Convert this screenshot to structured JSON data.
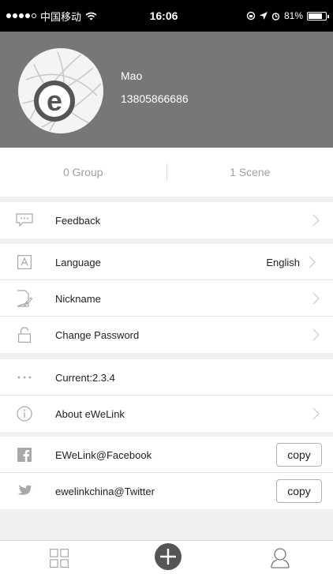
{
  "status_bar": {
    "carrier": "中国移动",
    "time": "16:06",
    "battery": "81%",
    "battery_level": 0.81
  },
  "profile": {
    "avatar_letter": "e",
    "name": "Mao",
    "phone": "13805866686"
  },
  "stats": {
    "group_label": "0 Group",
    "scene_label": "1 Scene"
  },
  "menu": {
    "feedback": "Feedback",
    "language": "Language",
    "language_value": "English",
    "nickname": "Nickname",
    "change_password": "Change Password",
    "current_version": "Current:2.3.4",
    "about": "About eWeLink",
    "facebook": "EWeLink@Facebook",
    "twitter": "ewelinkchina@Twitter",
    "copy_label": "copy"
  },
  "icons": {
    "feedback": "chat-bubble-icon",
    "language": "letter-a-icon",
    "nickname": "edit-document-icon",
    "change_password": "lock-icon",
    "current_version": "ellipsis-icon",
    "about": "info-icon",
    "facebook": "facebook-icon",
    "twitter": "twitter-icon",
    "tab_devices": "grid-icon",
    "tab_add": "plus-icon",
    "tab_profile": "user-icon"
  },
  "colors": {
    "header_bg": "#777777",
    "section_gap": "#efefef",
    "icon_gray": "#a8a8a8"
  }
}
